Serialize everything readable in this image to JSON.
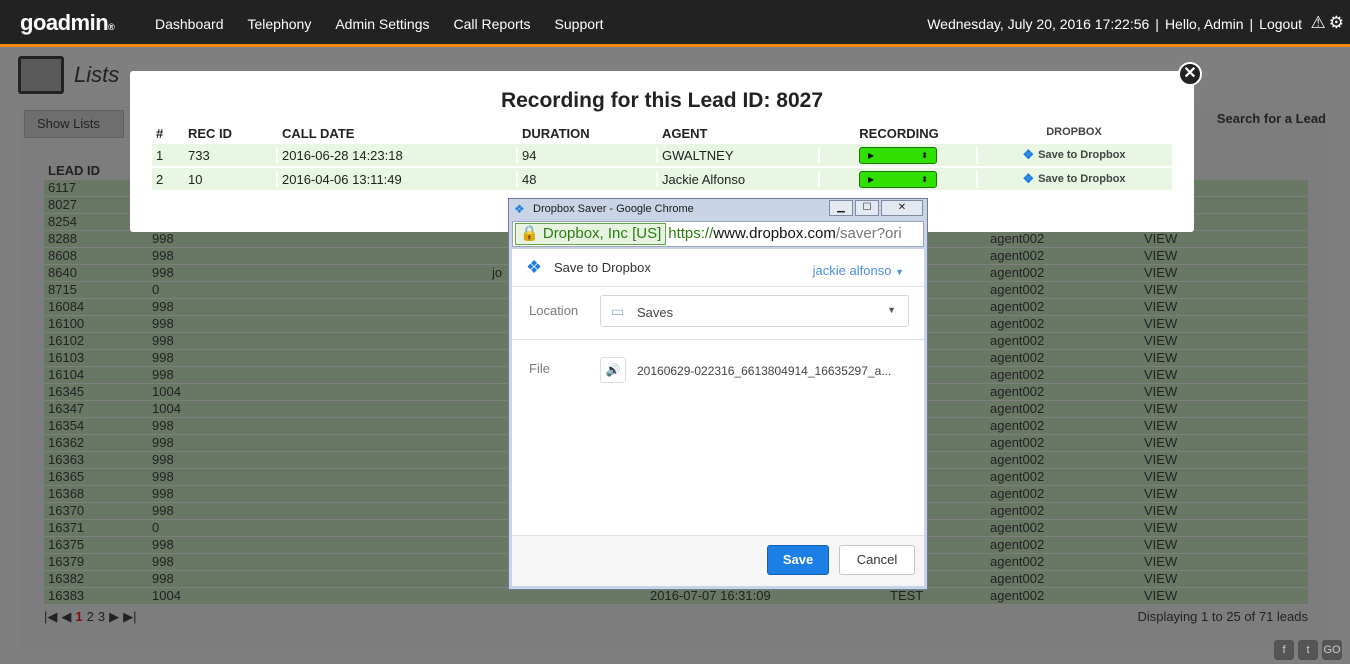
{
  "nav": {
    "logo": "goadmin",
    "logo_mark": "®",
    "items": [
      "Dashboard",
      "Telephony",
      "Admin Settings",
      "Call Reports",
      "Support"
    ],
    "datetime": "Wednesday, July 20, 2016 17:22:56",
    "separator": "|",
    "greeting": "Hello, Admin",
    "logout": "Logout"
  },
  "page": {
    "title": "Lists",
    "show_lists": "Show Lists",
    "search_lead": "Search for a Lead",
    "columns": [
      "LEAD ID",
      "",
      "",
      "",
      "",
      "",
      "DINGS"
    ],
    "rows": [
      {
        "lead_id": "6117",
        "list": "",
        "name": "",
        "date": "",
        "status": "",
        "agent": "",
        "rec": ""
      },
      {
        "lead_id": "8027",
        "list": "",
        "name": "",
        "date": "",
        "status": "",
        "agent": "",
        "rec": ""
      },
      {
        "lead_id": "8254",
        "list": "",
        "name": "",
        "date": "",
        "status": "",
        "agent": "",
        "rec": ""
      },
      {
        "lead_id": "8288",
        "list": "998",
        "name": "",
        "date": "",
        "status": "OT",
        "agent": "agent002",
        "rec": "VIEW"
      },
      {
        "lead_id": "8608",
        "list": "998",
        "name": "",
        "date": "",
        "status": "Y",
        "agent": "agent002",
        "rec": "VIEW"
      },
      {
        "lead_id": "8640",
        "list": "998",
        "name": "jo",
        "date": "",
        "status": "",
        "agent": "agent002",
        "rec": "VIEW"
      },
      {
        "lead_id": "8715",
        "list": "0",
        "name": "",
        "date": "",
        "status": "",
        "agent": "agent002",
        "rec": "VIEW"
      },
      {
        "lead_id": "16084",
        "list": "998",
        "name": "",
        "date": "",
        "status": "",
        "agent": "agent002",
        "rec": "VIEW"
      },
      {
        "lead_id": "16100",
        "list": "998",
        "name": "",
        "date": "",
        "status": "",
        "agent": "agent002",
        "rec": "VIEW"
      },
      {
        "lead_id": "16102",
        "list": "998",
        "name": "",
        "date": "",
        "status": "Y",
        "agent": "agent002",
        "rec": "VIEW"
      },
      {
        "lead_id": "16103",
        "list": "998",
        "name": "",
        "date": "",
        "status": "",
        "agent": "agent002",
        "rec": "VIEW"
      },
      {
        "lead_id": "16104",
        "list": "998",
        "name": "",
        "date": "",
        "status": "",
        "agent": "agent002",
        "rec": "VIEW"
      },
      {
        "lead_id": "16345",
        "list": "1004",
        "name": "",
        "date": "",
        "status": "",
        "agent": "agent002",
        "rec": "VIEW"
      },
      {
        "lead_id": "16347",
        "list": "1004",
        "name": "",
        "date": "",
        "status": "",
        "agent": "agent002",
        "rec": "VIEW"
      },
      {
        "lead_id": "16354",
        "list": "998",
        "name": "",
        "date": "",
        "status": "Y",
        "agent": "agent002",
        "rec": "VIEW"
      },
      {
        "lead_id": "16362",
        "list": "998",
        "name": "",
        "date": "",
        "status": "Y",
        "agent": "agent002",
        "rec": "VIEW"
      },
      {
        "lead_id": "16363",
        "list": "998",
        "name": "",
        "date": "",
        "status": "",
        "agent": "agent002",
        "rec": "VIEW"
      },
      {
        "lead_id": "16365",
        "list": "998",
        "name": "",
        "date": "",
        "status": "Y",
        "agent": "agent002",
        "rec": "VIEW"
      },
      {
        "lead_id": "16368",
        "list": "998",
        "name": "",
        "date": "",
        "status": "",
        "agent": "agent002",
        "rec": "VIEW"
      },
      {
        "lead_id": "16370",
        "list": "998",
        "name": "",
        "date": "",
        "status": "",
        "agent": "agent002",
        "rec": "VIEW"
      },
      {
        "lead_id": "16371",
        "list": "0",
        "name": "",
        "date": "",
        "status": "",
        "agent": "agent002",
        "rec": "VIEW"
      },
      {
        "lead_id": "16375",
        "list": "998",
        "name": "",
        "date": "",
        "status": "Y",
        "agent": "agent002",
        "rec": "VIEW"
      },
      {
        "lead_id": "16379",
        "list": "998",
        "name": "",
        "date": "",
        "status": "",
        "agent": "agent002",
        "rec": "VIEW"
      },
      {
        "lead_id": "16382",
        "list": "998",
        "name": "",
        "date": "",
        "status": "",
        "agent": "agent002",
        "rec": "VIEW"
      },
      {
        "lead_id": "16383",
        "list": "1004",
        "name": "",
        "date": "2016-07-07 16:31:09",
        "status": "TEST",
        "agent": "agent002",
        "rec": "VIEW"
      }
    ],
    "pager": {
      "first": "|◀",
      "prev": "◀",
      "pages": [
        "1",
        "2",
        "3"
      ],
      "next": "▶",
      "last": "▶|"
    },
    "displaying": "Displaying 1 to 25 of 71 leads"
  },
  "modal": {
    "title": "Recording for this Lead ID: 8027",
    "close": "✕",
    "headers": [
      "#",
      "REC ID",
      "CALL DATE",
      "DURATION",
      "AGENT",
      "RECORDING",
      "DROPBOX"
    ],
    "rows": [
      {
        "num": "1",
        "rec_id": "733",
        "call_date": "2016-06-28 14:23:18",
        "duration": "94",
        "agent": "GWALTNEY",
        "dropbox": "Save to Dropbox"
      },
      {
        "num": "2",
        "rec_id": "10",
        "call_date": "2016-04-06 13:11:49",
        "duration": "48",
        "agent": "Jackie Alfonso",
        "dropbox": "Save to Dropbox"
      }
    ]
  },
  "popup": {
    "window_title": "Dropbox Saver - Google Chrome",
    "ev_badge": "Dropbox, Inc [US]",
    "url_scheme": "https://",
    "url_host": "www.dropbox.com",
    "url_rest": "/saver?ori",
    "header": "Save to Dropbox",
    "user": "jackie alfonso",
    "location_label": "Location",
    "location_value": "Saves",
    "file_label": "File",
    "file_name": "20160629-022316_6613804914_16635297_a...",
    "save": "Save",
    "cancel": "Cancel"
  }
}
